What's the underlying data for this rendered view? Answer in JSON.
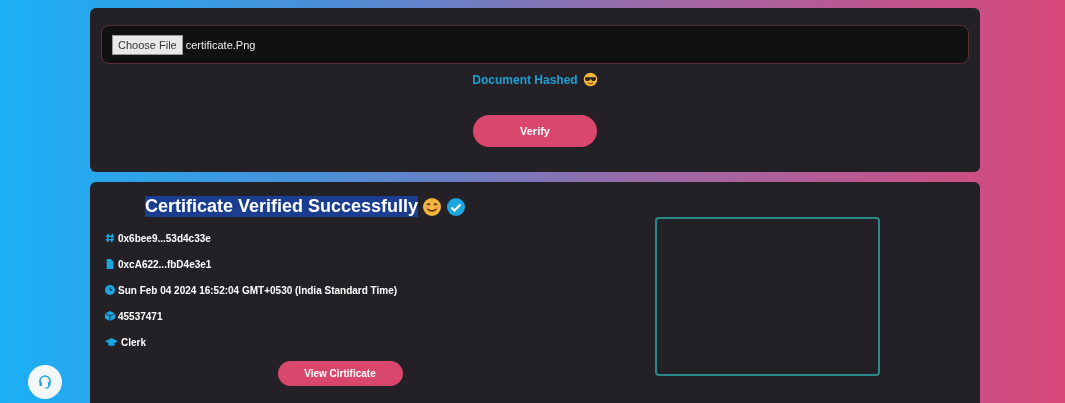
{
  "upload": {
    "button": "Choose File",
    "file_name": "certificate.Png"
  },
  "hash_status": "Document Hashed",
  "verify_button": "Verify",
  "result": {
    "title": "Certificate Verified Successfully",
    "title_selected": true,
    "details": [
      {
        "kind": "hash",
        "text": "0x6bee9...53d4c33e"
      },
      {
        "kind": "file",
        "text": "0xcA622...fbD4e3e1"
      },
      {
        "kind": "clock",
        "text": "Sun Feb 04 2024 16:52:04 GMT+0530 (India Standard Time)"
      },
      {
        "kind": "cube",
        "text": "45537471"
      },
      {
        "kind": "cap",
        "text": "Clerk"
      }
    ],
    "view_button": "View Cirtificate"
  }
}
